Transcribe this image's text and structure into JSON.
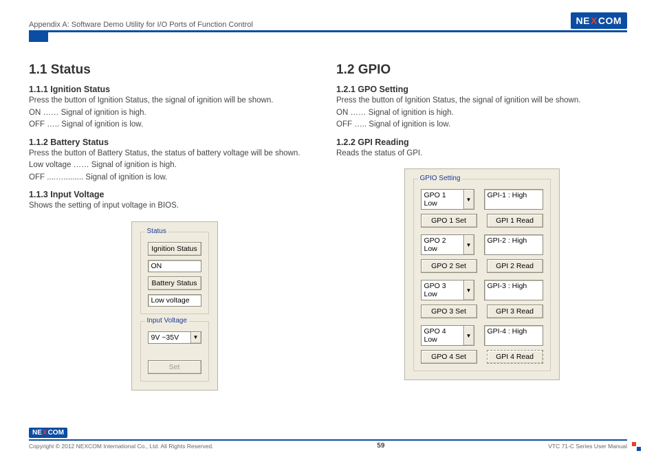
{
  "header": {
    "appendix": "Appendix A: Software Demo Utility for I/O Ports of Function Control",
    "logo1": "NE",
    "logoX": "X",
    "logo2": "COM"
  },
  "left": {
    "h2": "1.1  Status",
    "s1": {
      "h3": "1.1.1  Ignition Status",
      "p1": "Press the button of Ignition Status, the signal of ignition will be shown.",
      "p2": "ON …… Signal of ignition is high.",
      "p3": "OFF ….. Signal of ignition is low."
    },
    "s2": {
      "h3": "1.1.2  Battery Status",
      "p1": "Press the button of Battery Status, the status of battery voltage will be shown.",
      "p2": "Low voltage …… Signal of ignition is high.",
      "p3": "OFF ....…......... Signal of ignition is low."
    },
    "s3": {
      "h3": "1.1.3  Input Voltage",
      "p1": "Shows the setting of input voltage in BIOS."
    },
    "panel": {
      "group1": "Status",
      "btn_ign": "Ignition Status",
      "val_ign": "ON",
      "btn_bat": "Battery Status",
      "val_bat": "Low voltage",
      "group2": "Input Voltage",
      "val_iv": "9V ~35V",
      "btn_set": "Set"
    }
  },
  "right": {
    "h2": "1.2  GPIO",
    "s1": {
      "h3": "1.2.1  GPO Setting",
      "p1": "Press the button of Ignition Status, the signal of ignition will be shown.",
      "p2": "ON …… Signal of ignition is high.",
      "p3": "OFF ….. Signal of ignition is low."
    },
    "s2": {
      "h3": "1.2.2  GPI Reading",
      "p1": "Reads the status of GPI."
    },
    "panel": {
      "group": "GPIO Setting",
      "rows": {
        "r1": {
          "sel": "GPO 1 Low",
          "txt": "GPI-1 : High",
          "btnL": "GPO 1 Set",
          "btnR": "GPI 1 Read"
        },
        "r2": {
          "sel": "GPO 2 Low",
          "txt": "GPI-2 : High",
          "btnL": "GPO 2 Set",
          "btnR": "GPI 2 Read"
        },
        "r3": {
          "sel": "GPO 3 Low",
          "txt": "GPI-3 : High",
          "btnL": "GPO 3 Set",
          "btnR": "GPI 3 Read"
        },
        "r4": {
          "sel": "GPO 4 Low",
          "txt": "GPI-4 : High",
          "btnL": "GPO 4 Set",
          "btnR": "GPI 4 Read"
        }
      }
    }
  },
  "footer": {
    "copy": "Copyright © 2012 NEXCOM International Co., Ltd. All Rights Reserved.",
    "page": "59",
    "manual": "VTC 71-C Series User Manual"
  }
}
